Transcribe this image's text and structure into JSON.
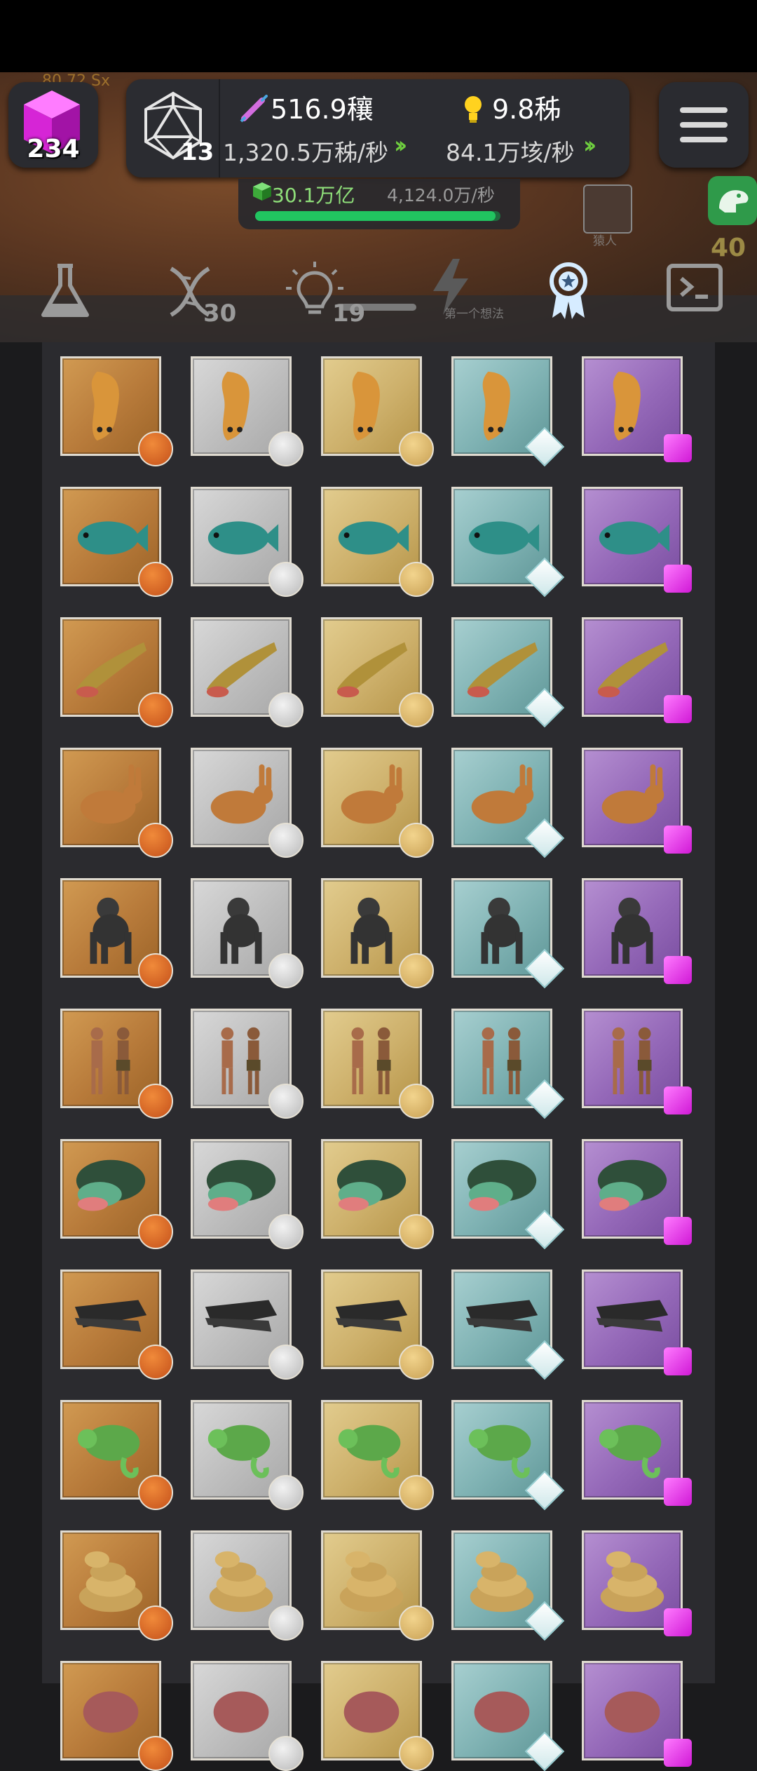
{
  "header": {
    "cube_count": "234",
    "level": "13",
    "resource_primary": "516.9穰",
    "resource_secondary": "9.8秭",
    "rate_primary": "1,320.5万秭/秒",
    "rate_secondary": "84.1万垓/秒",
    "sub_total": "30.1万亿",
    "sub_rate": "4,124.0万/秒",
    "sub_progress": 0.98,
    "dino_level": "40",
    "faint_top_text": "80.72 Sx",
    "faint_human_label": "猿人",
    "faint_idea_label": "第一个想法"
  },
  "tabs": [
    {
      "name": "lab",
      "icon": "flask-icon",
      "count": ""
    },
    {
      "name": "dna",
      "icon": "dna-icon",
      "count": "30"
    },
    {
      "name": "ideas",
      "icon": "lightbulb-icon",
      "count": "19"
    },
    {
      "name": "energy",
      "icon": "lightning-icon",
      "count": ""
    },
    {
      "name": "achievements",
      "icon": "award-ribbon-icon",
      "count": "",
      "active": true
    },
    {
      "name": "console",
      "icon": "terminal-icon",
      "count": ""
    }
  ],
  "tiers": [
    "bronze",
    "silver",
    "gold",
    "diamond",
    "purple"
  ],
  "creatures": [
    {
      "id": "worm",
      "icon": "worm-icon"
    },
    {
      "id": "fish",
      "icon": "fish-icon"
    },
    {
      "id": "amphibian",
      "icon": "amphibian-icon"
    },
    {
      "id": "rabbit",
      "icon": "rabbit-icon"
    },
    {
      "id": "chimp",
      "icon": "chimpanzee-icon"
    },
    {
      "id": "humans",
      "icon": "human-couple-icon"
    },
    {
      "id": "turtle",
      "icon": "turtle-icon"
    },
    {
      "id": "crocodile",
      "icon": "crocodile-icon"
    },
    {
      "id": "chameleon",
      "icon": "chameleon-icon"
    },
    {
      "id": "snake",
      "icon": "snake-icon"
    },
    {
      "id": "partial",
      "icon": "creature-icon"
    }
  ],
  "colors": {
    "accent_green": "#21c460",
    "chevron_green": "#6fcf3f",
    "purple_gem": "#e12ee6"
  }
}
